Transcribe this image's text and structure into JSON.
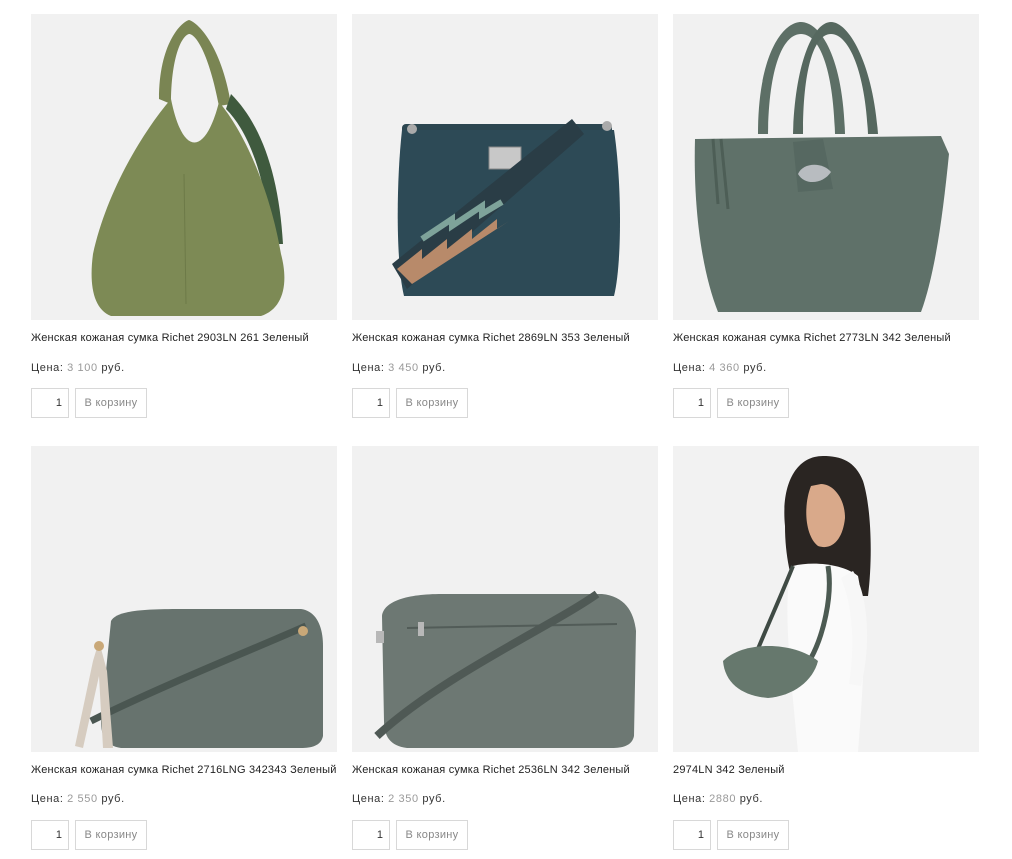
{
  "products": [
    {
      "title": "Женская кожаная сумка Richet 2903LN 261 Зеленый",
      "price_label": "Цена:",
      "price": "3 100",
      "currency": "руб.",
      "qty": "1",
      "cart_label": "В корзину",
      "image": "olive-hobo-bag"
    },
    {
      "title": "Женская кожаная сумка Richet 2869LN 353 Зеленый",
      "price_label": "Цена:",
      "price": "3 450",
      "currency": "руб.",
      "qty": "1",
      "cart_label": "В корзину",
      "image": "teal-bucket-bag-with-pattern-strap"
    },
    {
      "title": "Женская кожаная сумка Richet 2773LN 342 Зеленый",
      "price_label": "Цена:",
      "price": "4 360",
      "currency": "руб.",
      "qty": "1",
      "cart_label": "В корзину",
      "image": "grey-green-tote-bag"
    },
    {
      "title": "Женская кожаная сумка Richet 2716LNG 342343 Зеленый",
      "price_label": "Цена:",
      "price": "2 550",
      "currency": "руб.",
      "qty": "1",
      "cart_label": "В корзину",
      "image": "grey-green-crossbody-with-tassel"
    },
    {
      "title": "Женская кожаная сумка Richet 2536LN 342 Зеленый",
      "price_label": "Цена:",
      "price": "2 350",
      "currency": "руб.",
      "qty": "1",
      "cart_label": "В корзину",
      "image": "grey-green-zip-crossbody"
    },
    {
      "title": "2974LN 342 Зеленый",
      "price_label": "Цена:",
      "price": "2880",
      "currency": "руб.",
      "qty": "1",
      "cart_label": "В корзину",
      "image": "model-with-green-bag"
    }
  ],
  "colors": {
    "image_bg": "#f1f1f1",
    "border": "#d8d8d8",
    "price_amount": "#999999"
  }
}
